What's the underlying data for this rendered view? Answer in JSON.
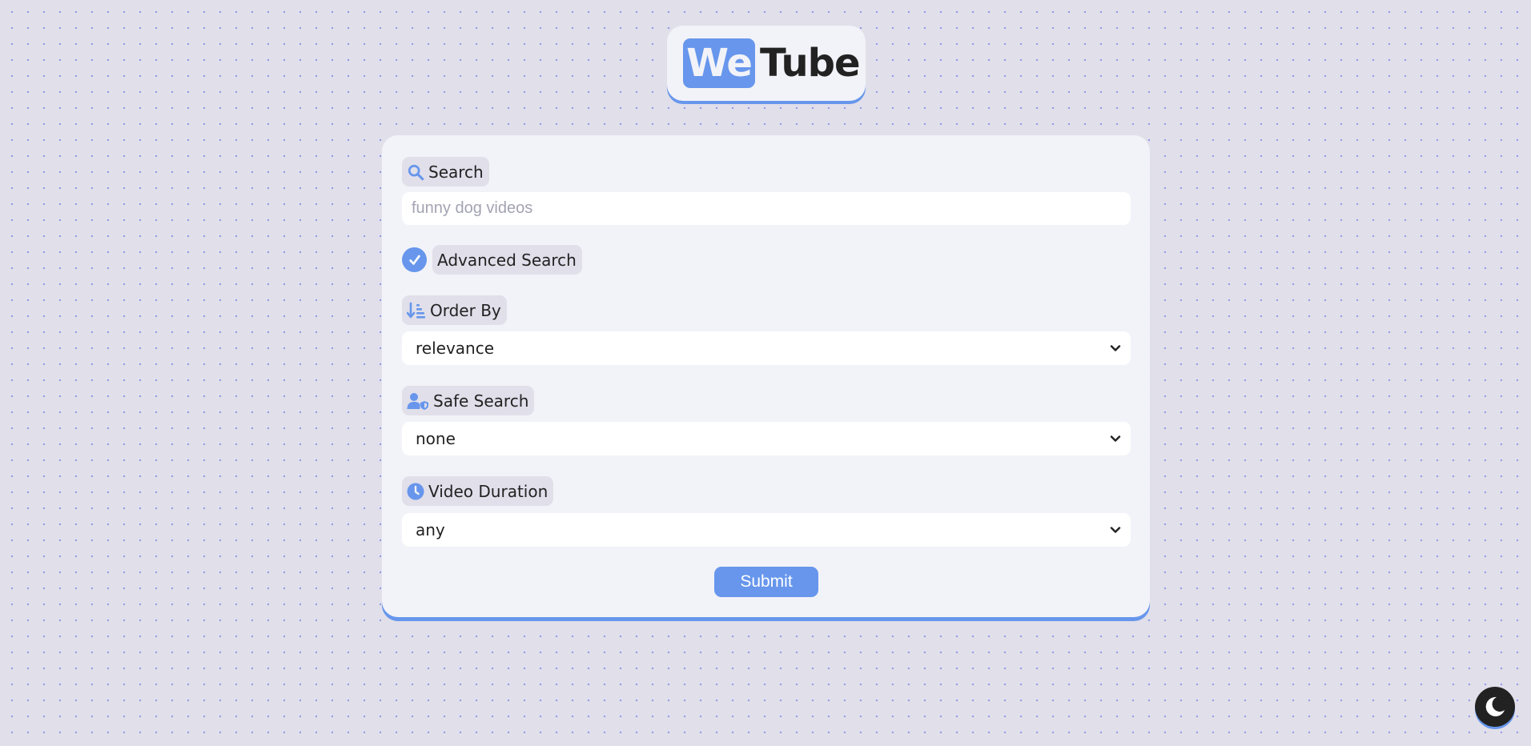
{
  "logo": {
    "part1": "We",
    "part2": "Tube"
  },
  "search": {
    "label": "Search",
    "icon": "search-icon",
    "placeholder": "funny dog videos",
    "value": ""
  },
  "advanced_search": {
    "label": "Advanced Search",
    "checked": true
  },
  "order_by": {
    "label": "Order By",
    "icon": "sort-icon",
    "selected": "relevance"
  },
  "safe_search": {
    "label": "Safe Search",
    "icon": "user-shield-icon",
    "selected": "none"
  },
  "video_duration": {
    "label": "Video Duration",
    "icon": "clock-icon",
    "selected": "any"
  },
  "submit": {
    "label": "Submit"
  },
  "theme_toggle": {
    "icon": "moon-icon"
  },
  "colors": {
    "accent": "#6796ec",
    "background": "#e0dfea",
    "card": "#f2f3f8",
    "text": "#222222"
  }
}
